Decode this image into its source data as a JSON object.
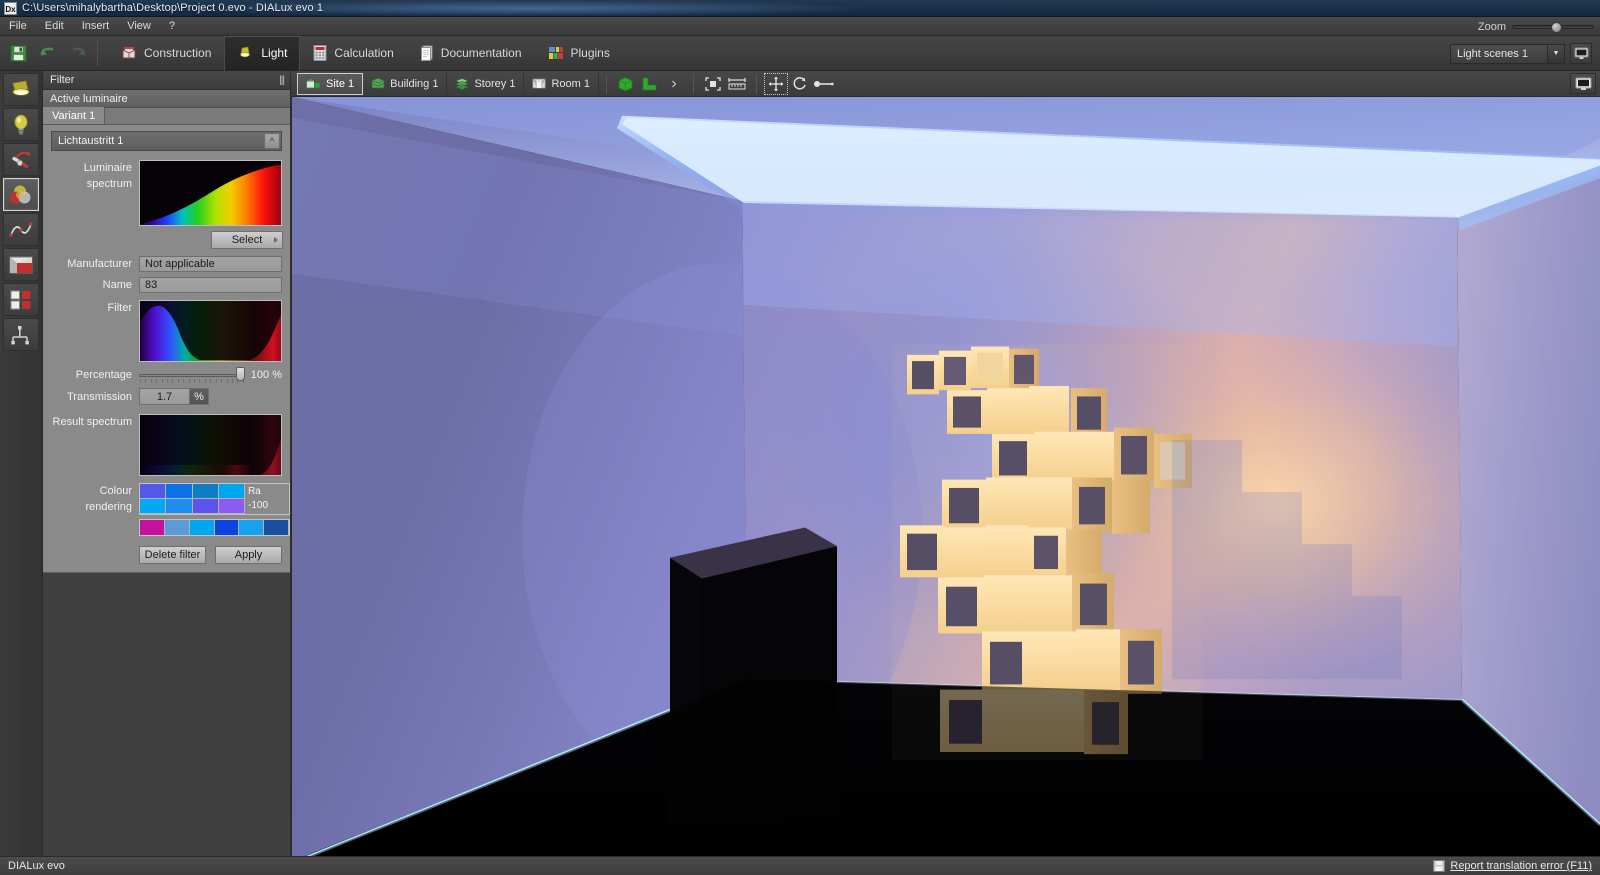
{
  "window": {
    "title": "C:\\Users\\mihalybartha\\Desktop\\Project 0.evo - DIALux evo 1",
    "app_icon": "Dx"
  },
  "menu": {
    "items": [
      "File",
      "Edit",
      "Insert",
      "View",
      "?"
    ],
    "zoom_label": "Zoom"
  },
  "ribbon": {
    "quick_icons": [
      "save-icon",
      "undo-icon",
      "redo-icon"
    ],
    "tabs": [
      {
        "label": "Construction",
        "icon": "construction-icon",
        "active": false
      },
      {
        "label": "Light",
        "icon": "light-bulb-icon",
        "active": true
      },
      {
        "label": "Calculation",
        "icon": "calculator-icon",
        "active": false
      },
      {
        "label": "Documentation",
        "icon": "document-icon",
        "active": false
      },
      {
        "label": "Plugins",
        "icon": "plugins-icon",
        "active": false
      }
    ],
    "light_scenes": "Light scenes 1",
    "monitor_button": "monitor-icon"
  },
  "rail": {
    "items": [
      {
        "name": "spotlight-tool",
        "active": false
      },
      {
        "name": "lamp-tool",
        "active": false
      },
      {
        "name": "light-arrangement-tool",
        "active": false
      },
      {
        "name": "colour-filter-tool",
        "active": true
      },
      {
        "name": "light-curve-tool",
        "active": false
      },
      {
        "name": "surface-light-tool",
        "active": false
      },
      {
        "name": "light-scene-grid-tool",
        "active": false
      },
      {
        "name": "light-group-tool",
        "active": false
      }
    ]
  },
  "panel": {
    "title": "Filter",
    "subtitle": "Active luminaire",
    "tab": "Variant 1",
    "luminaire_select": "Lichtaustritt 1",
    "labels": {
      "luminaire_spectrum": "Luminaire spectrum",
      "manufacturer": "Manufacturer",
      "name": "Name",
      "filter": "Filter",
      "percentage": "Percentage",
      "transmission": "Transmission",
      "result_spectrum": "Result spectrum",
      "colour_rendering": "Colour rendering"
    },
    "select_button": "Select",
    "manufacturer_value": "Not applicable",
    "name_value": "83",
    "percentage_value": "100 %",
    "transmission_value": "1.7",
    "transmission_unit": "%",
    "ra_label": "Ra",
    "ra_value": "-100",
    "cri_row1": [
      "#5358e8",
      "#0c72e6",
      "#0f7dc4",
      "#00a5f0",
      "#00a9f5",
      "#1d8ef0",
      "#5b53ec",
      "#8a5cf3"
    ],
    "cri_row2": [
      "#c4119e",
      "#5a9bd8",
      "#00a5f0",
      "#0b44e0",
      "#17a2ef",
      "#1a4fa0"
    ],
    "delete_button": "Delete filter",
    "apply_button": "Apply"
  },
  "viewbar": {
    "levels": [
      {
        "label": "Site 1",
        "icon": "site-icon",
        "selected": true
      },
      {
        "label": "Building 1",
        "icon": "building-icon",
        "selected": false
      },
      {
        "label": "Storey 1",
        "icon": "storey-icon",
        "selected": false
      },
      {
        "label": "Room 1",
        "icon": "room-icon",
        "selected": false
      }
    ],
    "shape_tools": [
      "cube-icon",
      "lshape-icon",
      "more-chevron-icon"
    ],
    "view_tools": [
      "fit-view-icon",
      "measure-icon"
    ],
    "transform_tools": [
      "move-icon",
      "rotate-icon",
      "scale-icon"
    ],
    "right_tools": [
      "fullscreen-view-icon"
    ]
  },
  "status": {
    "left": "DIALux evo",
    "right_label": "Report translation error (F11)",
    "right_icon": "save-icon"
  },
  "scene": {
    "description": "3D rendered interior room with cove lighting, blue-violet walls, warm orange glow behind a stacked cube sculpture, dark floor"
  }
}
